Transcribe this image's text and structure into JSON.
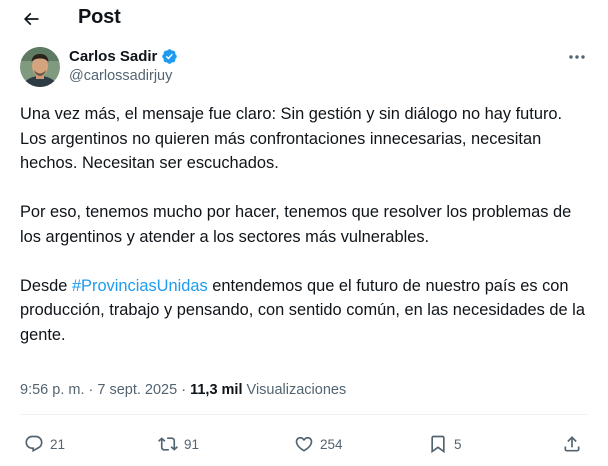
{
  "header": {
    "title": "Post"
  },
  "author": {
    "name": "Carlos Sadir",
    "handle": "@carlossadirjuy"
  },
  "tweet": {
    "p1_line1": "Una vez más, el mensaje fue claro: Sin gestión y sin diálogo no hay futuro.",
    "p1_line2": "Los argentinos no quieren más confrontaciones innecesarias, necesitan hechos. Necesitan ser escuchados.",
    "p2": "Por eso, tenemos mucho por hacer, tenemos que resolver los problemas de los argentinos y atender a los sectores más vulnerables.",
    "p3_before": "Desde ",
    "p3_hashtag": "#ProvinciasUnidas",
    "p3_after": " entendemos que el futuro de nuestro país es con producción, trabajo y pensando, con sentido común,  en las necesidades de la gente."
  },
  "meta": {
    "time": "9:56 p. m.",
    "separator": " · ",
    "date": "7 sept. 2025",
    "views_count": "11,3 mil",
    "views_label": "Visualizaciones"
  },
  "actions": {
    "replies": "21",
    "reposts": "91",
    "likes": "254",
    "bookmarks": "5"
  },
  "colors": {
    "accent": "#1d9bf0",
    "text": "#0f1419",
    "muted": "#536471",
    "divider": "#eff3f4"
  },
  "icons": [
    "back-arrow-icon",
    "verified-badge-icon",
    "more-icon",
    "reply-icon",
    "repost-icon",
    "like-icon",
    "bookmark-icon",
    "share-icon"
  ]
}
